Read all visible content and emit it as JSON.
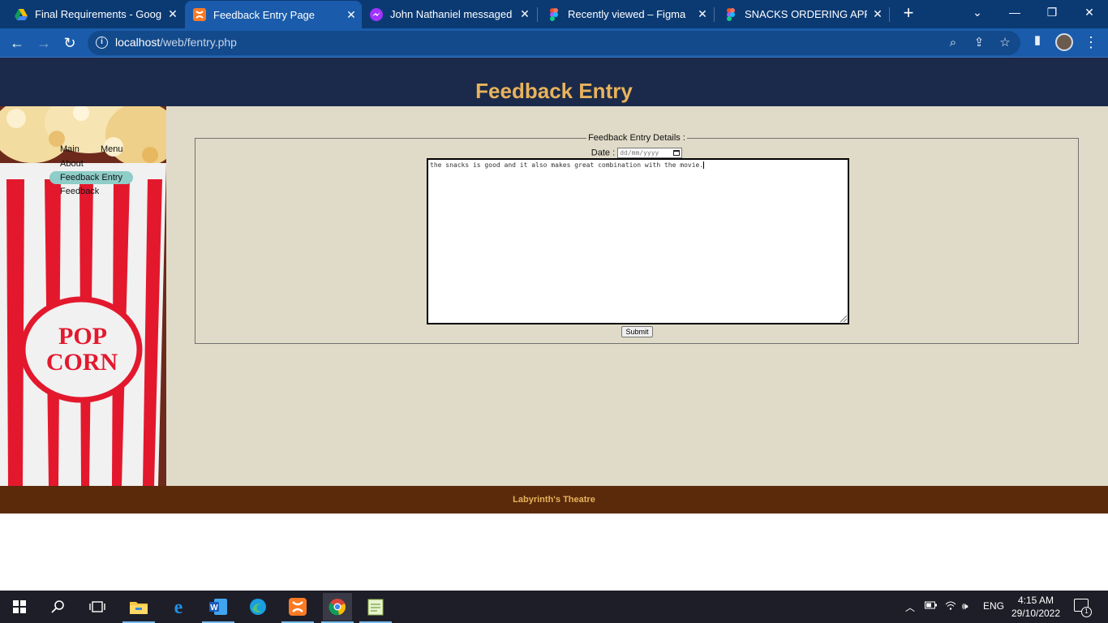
{
  "browser": {
    "tabs": [
      {
        "title": "Final Requirements - Google",
        "icon": "google-drive-icon",
        "active": false
      },
      {
        "title": "Feedback Entry Page",
        "icon": "xampp-icon",
        "active": true
      },
      {
        "title": "John Nathaniel messaged yo",
        "icon": "messenger-icon",
        "active": false
      },
      {
        "title": "Recently viewed – Figma",
        "icon": "figma-icon",
        "active": false
      },
      {
        "title": "SNACKS ORDERING APP FOR",
        "icon": "figma-icon",
        "active": false
      }
    ],
    "close_glyph": "✕",
    "new_tab_glyph": "+",
    "url_host": "localhost",
    "url_path": "/web/fentry.php"
  },
  "page": {
    "title": "Feedback Entry",
    "menu": {
      "items": [
        {
          "label": "Main",
          "active": false
        },
        {
          "label": "Menu",
          "active": false
        },
        {
          "label": "About",
          "active": false
        },
        {
          "label": "Feedback Entry",
          "active": true
        },
        {
          "label": "Feedback",
          "active": false
        }
      ]
    },
    "sidebar_image_text": [
      "POP",
      "CORN"
    ],
    "form": {
      "legend": "Feedback Entry Details :",
      "date_label": "Date :",
      "date_placeholder": "dd/mm/yyyy",
      "feedback_value": "the snacks is good and it also makes great combination with the movie.",
      "submit_label": "Submit"
    },
    "footer": "Labyrinth's Theatre"
  },
  "taskbar": {
    "tray_language": "ENG",
    "time": "4:15 AM",
    "date": "29/10/2022",
    "notification_count": "1"
  },
  "colors": {
    "header_bg": "#1b2a4a",
    "title_color": "#e9b35c",
    "content_bg": "#e0dbc8",
    "footer_bg": "#5a2a0a",
    "active_menu_bg": "#8ecdc8"
  }
}
